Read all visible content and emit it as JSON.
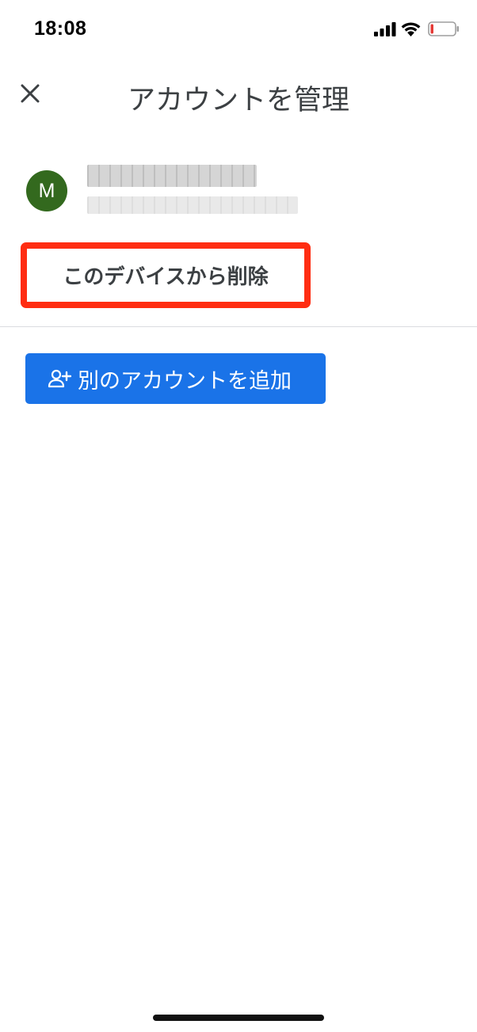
{
  "status_bar": {
    "time": "18:08",
    "icons": [
      "signal-icon",
      "wifi-icon",
      "battery-low-icon"
    ],
    "battery_level": 0.12,
    "battery_color": "#e53935"
  },
  "header": {
    "title": "アカウントを管理",
    "close_icon": "close-icon"
  },
  "account": {
    "avatar_letter": "M",
    "avatar_color": "#33691e"
  },
  "actions": {
    "remove_label": "このデバイスから削除",
    "highlight_color": "#ff2d12",
    "add_account_label": "別のアカウントを追加",
    "add_account_icon": "person-add-icon",
    "add_account_color": "#1a73e8"
  }
}
